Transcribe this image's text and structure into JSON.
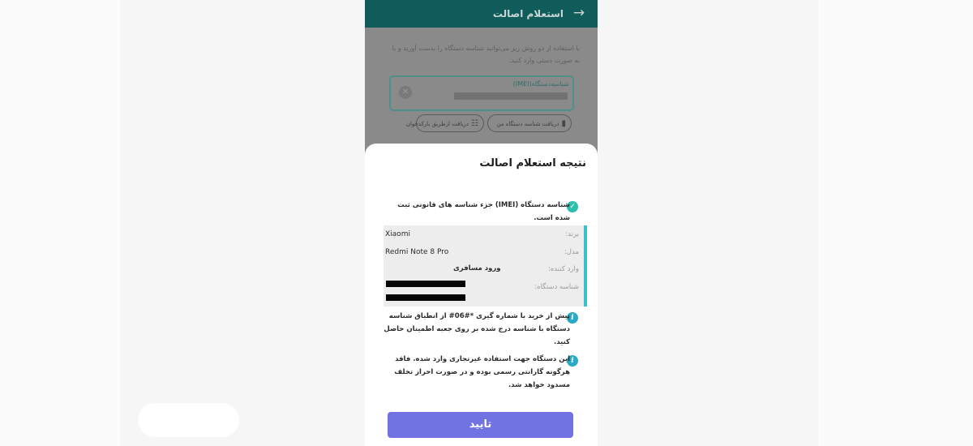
{
  "background_screen": {
    "title": "استعلام اصالت",
    "back_icon": "arrow-right-icon",
    "description": "با استفاده از دو روش زیر می‌توانید شناسه دستگاه را بدست آورید و یا به صورت دستی وارد کنید.",
    "imei_field": {
      "label": "شناسه‌دستگاه(IMEI)"
    },
    "get_my_id_button": "دریافت شناسه دستگاه من",
    "barcode_button": "دریافت ازطریق بارکدخوان"
  },
  "sheet": {
    "title": "نتیجه استعلام اصالت",
    "status_message": "شناسه دستگاه (IMEI) جزء شناسه های قانونی ثبت شده است.",
    "device_info": {
      "brand_label": "برند:",
      "brand_value": "Xiaomi",
      "model_label": "مدل:",
      "model_value": "Redmi Note 8 Pro",
      "importer_label": "وارد کننده:",
      "importer_value": "ورود مسافری",
      "device_id_label": "شناسه دستگاه:"
    },
    "tip_message": "پیش از خرید با شماره گیری *#06# از انطباق شناسه دستگاه با شناسه درج شده بر روی جعبه اطمینان حاصل کنید.",
    "warning_message": "این دستگاه جهت استفاده غیرتجاری وارد شده. فاقد هرگونه گارانتی رسمی بوده و در صورت احراز تخلف مسدود خواهد شد.",
    "confirm_button": "تایید"
  },
  "colors": {
    "appbar": "#0f5c5a",
    "accent_check": "#2dbfad",
    "accent_info": "#2aaac4",
    "card_border": "#39c0cd",
    "button": "#7273e2"
  }
}
